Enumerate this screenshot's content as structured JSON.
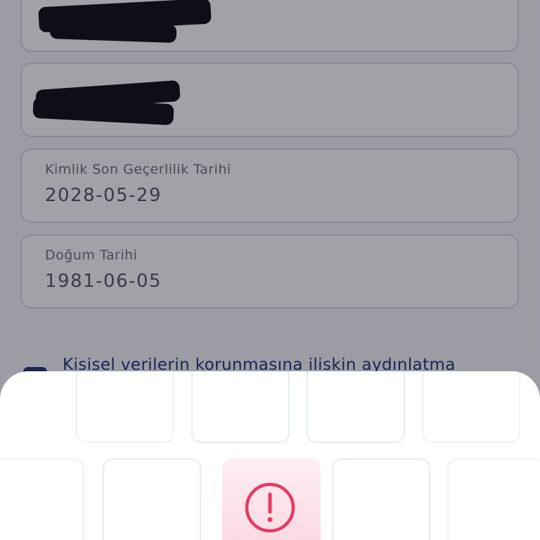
{
  "form": {
    "fields": [
      {
        "label": "",
        "value": "",
        "redacted": true
      },
      {
        "label": "",
        "value": "",
        "redacted": true
      },
      {
        "label": "Kimlik Son Geçerlilik Tarihi",
        "value": "2028-05-29"
      },
      {
        "label": "Doğum Tarihi",
        "value": "1981-06-05"
      }
    ],
    "consent_text": "Kisisel verilerin korunmasına iliskin aydınlatma"
  },
  "sheet": {
    "icon": "alert-circle-icon",
    "accent_color": "#e8395f"
  }
}
